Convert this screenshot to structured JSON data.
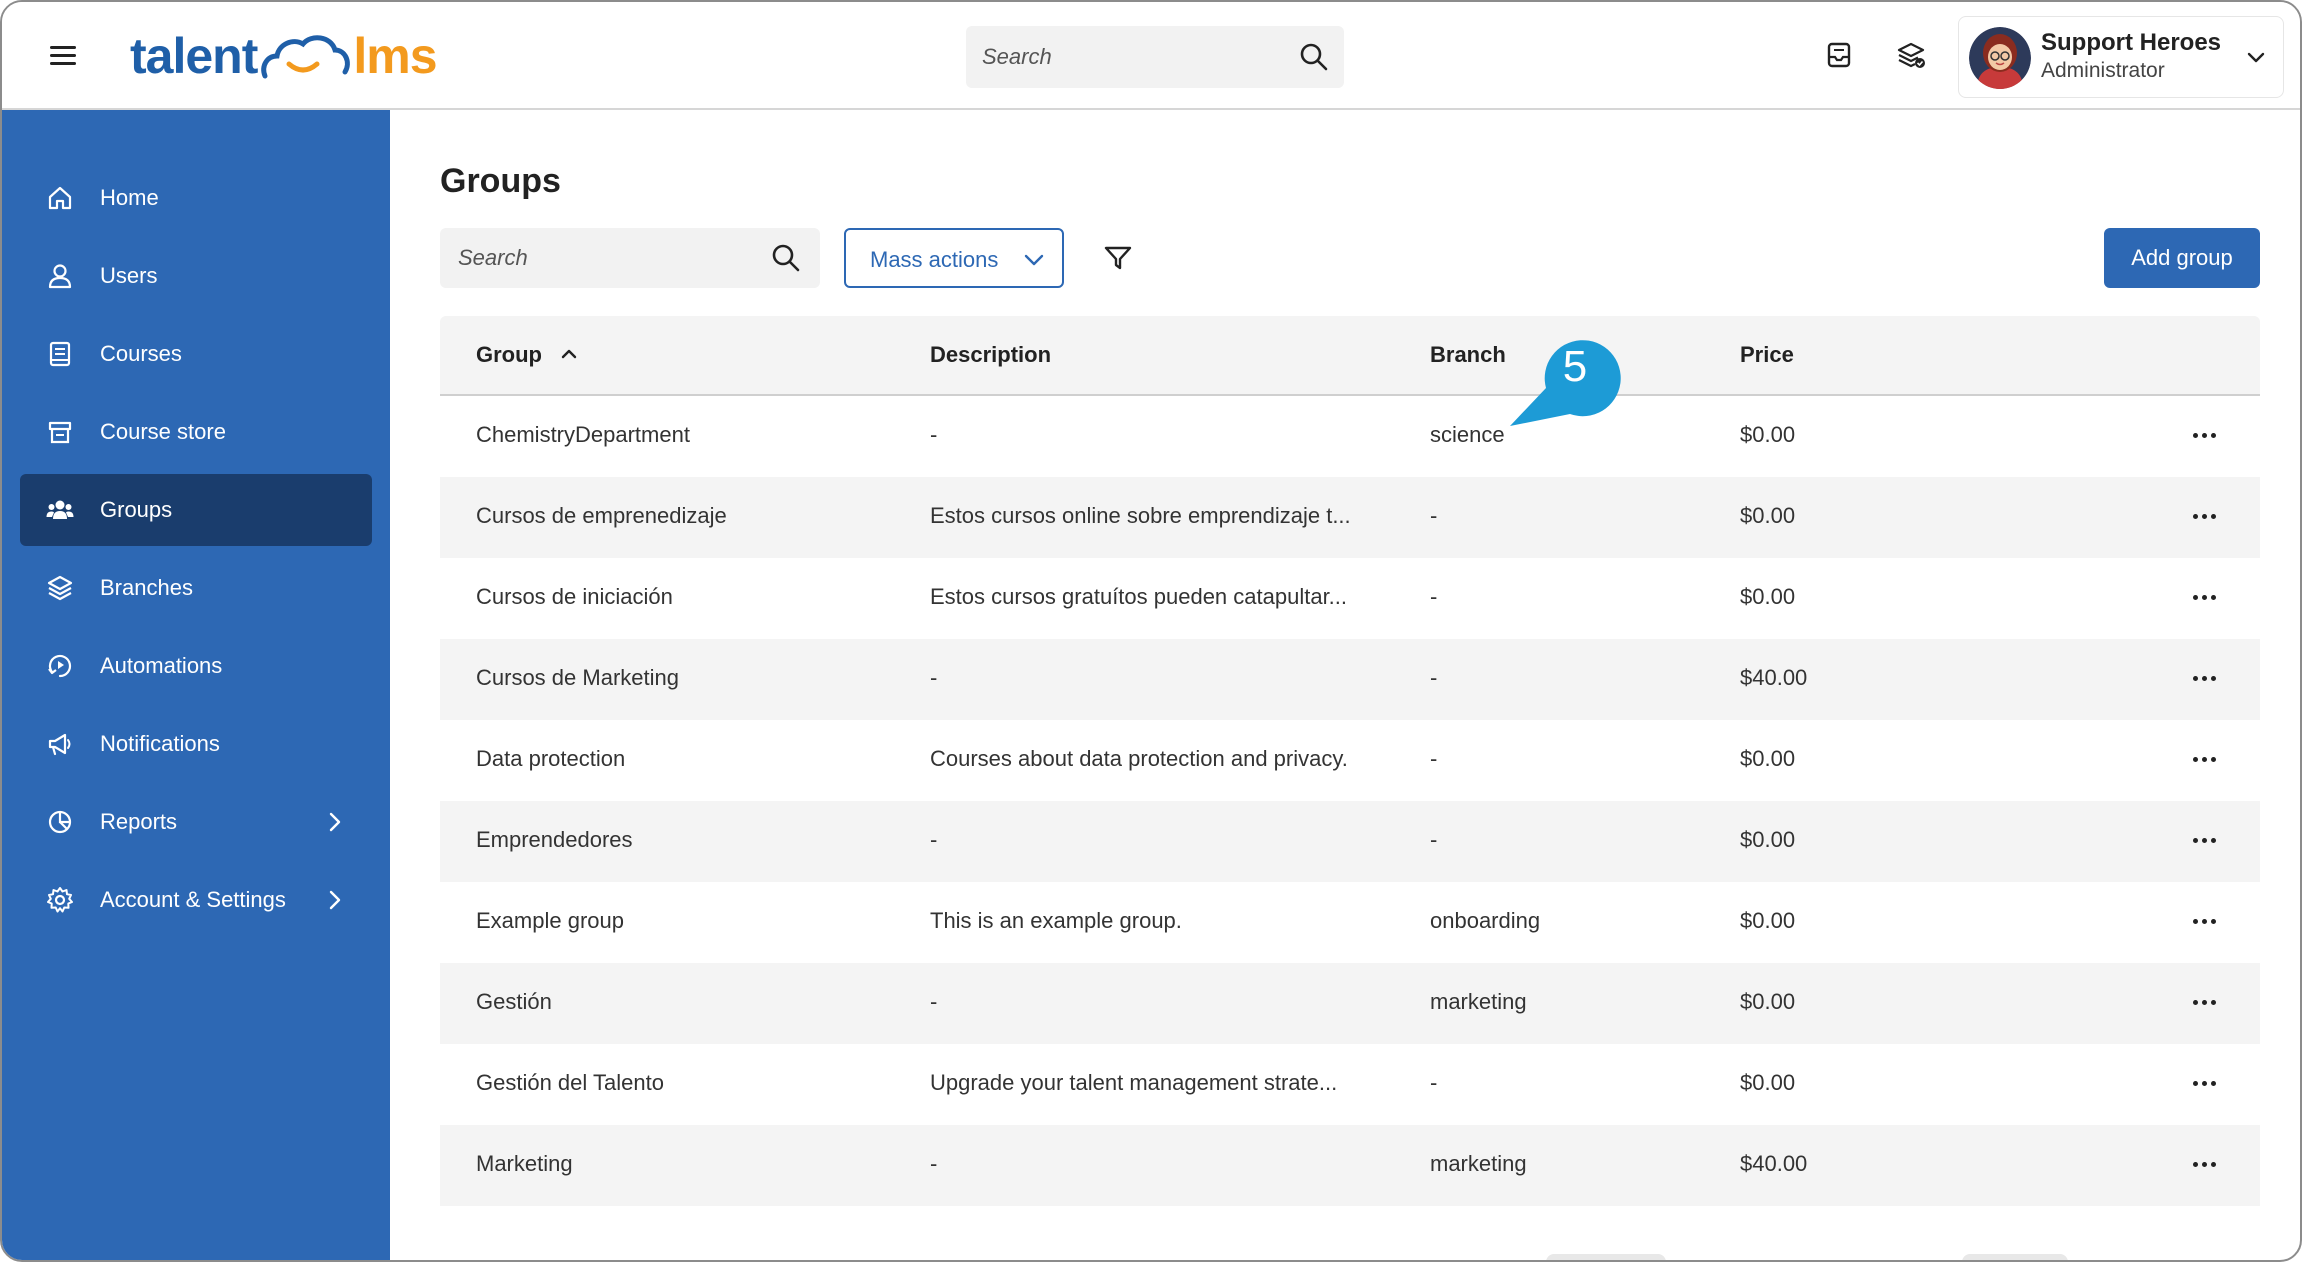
{
  "app": {
    "logo_left": "talent",
    "logo_right": "lms",
    "accent": "#2d68b4",
    "sidebar_bg": "#2d68b4",
    "sidebar_active_bg": "#1a3d6d",
    "logo_blue": "#1f5fa8",
    "logo_orange": "#f39a1e"
  },
  "topbar": {
    "search_placeholder": "Search",
    "icons": [
      "menu-icon",
      "search-icon",
      "messages-icon",
      "catalog-icon",
      "chevron-down-icon"
    ],
    "user": {
      "name": "Support Heroes",
      "role": "Administrator"
    }
  },
  "sidebar": {
    "items": [
      {
        "label": "Home",
        "icon": "home-icon"
      },
      {
        "label": "Users",
        "icon": "user-icon"
      },
      {
        "label": "Courses",
        "icon": "book-icon"
      },
      {
        "label": "Course store",
        "icon": "store-icon"
      },
      {
        "label": "Groups",
        "icon": "groups-icon",
        "active": true
      },
      {
        "label": "Branches",
        "icon": "layers-icon"
      },
      {
        "label": "Automations",
        "icon": "automation-icon"
      },
      {
        "label": "Notifications",
        "icon": "megaphone-icon"
      },
      {
        "label": "Reports",
        "icon": "pie-chart-icon",
        "has_submenu": true
      },
      {
        "label": "Account & Settings",
        "icon": "gear-icon",
        "has_submenu": true
      }
    ]
  },
  "main": {
    "title": "Groups",
    "search_placeholder": "Search",
    "mass_actions_label": "Mass actions",
    "add_button_label": "Add group",
    "callout_number": "5"
  },
  "table": {
    "columns": [
      "Group",
      "Description",
      "Branch",
      "Price"
    ],
    "sort_column": "Group",
    "sort_direction": "ascending",
    "rows": [
      {
        "group": "ChemistryDepartment",
        "description": "-",
        "branch": "science",
        "price": "$0.00"
      },
      {
        "group": "Cursos de emprenedizaje",
        "description": "Estos cursos online sobre emprendizaje t...",
        "branch": "-",
        "price": "$0.00"
      },
      {
        "group": "Cursos de iniciación",
        "description": "Estos cursos gratuítos pueden catapultar...",
        "branch": "-",
        "price": "$0.00"
      },
      {
        "group": "Cursos de Marketing",
        "description": "-",
        "branch": "-",
        "price": "$40.00"
      },
      {
        "group": "Data protection",
        "description": "Courses about data protection and privacy.",
        "branch": "-",
        "price": "$0.00"
      },
      {
        "group": "Emprendedores",
        "description": "-",
        "branch": "-",
        "price": "$0.00"
      },
      {
        "group": "Example group",
        "description": "This is an example group.",
        "branch": "onboarding",
        "price": "$0.00"
      },
      {
        "group": "Gestión",
        "description": "-",
        "branch": "marketing",
        "price": "$0.00"
      },
      {
        "group": "Gestión del Talento",
        "description": "Upgrade your talent management strate...",
        "branch": "-",
        "price": "$0.00"
      },
      {
        "group": "Marketing",
        "description": "-",
        "branch": "marketing",
        "price": "$40.00"
      }
    ]
  }
}
